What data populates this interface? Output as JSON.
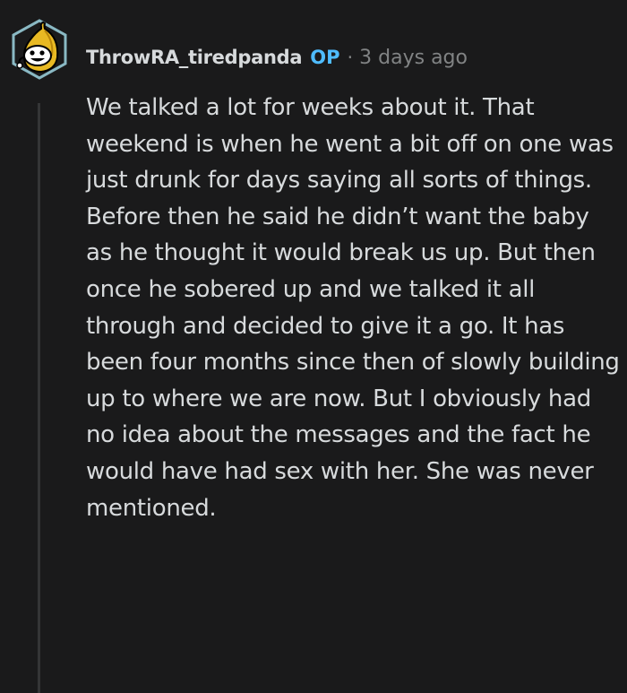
{
  "comment": {
    "username": "ThrowRA_tiredpanda",
    "op_badge": "OP",
    "separator": "·",
    "timestamp": "3 days ago",
    "avatar_icon": "banana-snoo-avatar-icon",
    "body": "We talked a lot for weeks about it. That weekend is when he went a bit off on one was just drunk for days saying all sorts of things. Before then he said he didn’t want the baby as he thought it would break us up. But then once he sobered up and we talked it all through and decided to give it a go. It has been four months since then of slowly building up to where we are now. But I obviously had no idea about the messages and the fact he would have had sex with her. She was never mentioned."
  },
  "colors": {
    "background": "#1a1a1b",
    "text": "#d7dadc",
    "meta": "#818384",
    "op_badge": "#4fbcff",
    "thread_line": "#343536"
  }
}
